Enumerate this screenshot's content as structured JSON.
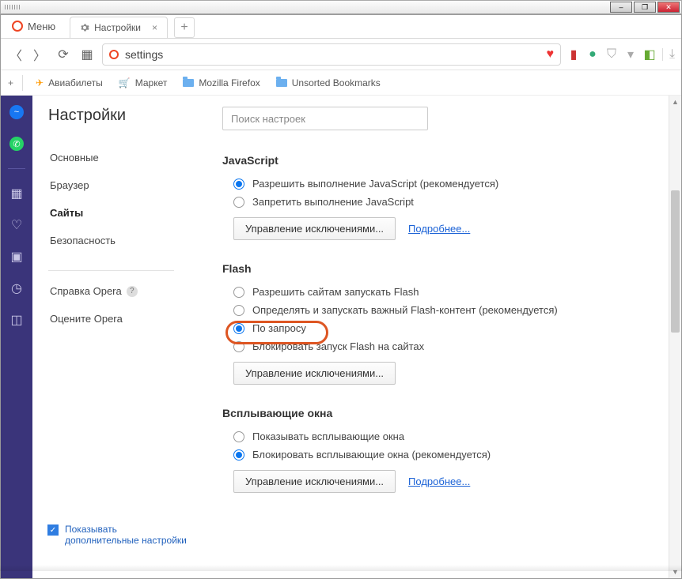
{
  "window": {
    "minimize": "–",
    "maximize": "❐",
    "close": "✕"
  },
  "menu_label": "Меню",
  "tab": {
    "title": "Настройки",
    "close": "×",
    "new": "+"
  },
  "url": {
    "value": "settings"
  },
  "bookmarks": {
    "add": "+",
    "items": [
      {
        "label": "Авиабилеты"
      },
      {
        "label": "Маркет"
      },
      {
        "label": "Mozilla Firefox"
      },
      {
        "label": "Unsorted Bookmarks"
      }
    ]
  },
  "settings_title": "Настройки",
  "nav": {
    "main": [
      "Основные",
      "Браузер",
      "Сайты",
      "Безопасность"
    ],
    "active_index": 2,
    "secondary": [
      "Справка Opera",
      "Оцените Opera"
    ]
  },
  "advanced_checkbox": "Показывать дополнительные настройки",
  "search_placeholder": "Поиск настроек",
  "sections": {
    "js": {
      "title": "JavaScript",
      "opt1": "Разрешить выполнение JavaScript (рекомендуется)",
      "opt2": "Запретить выполнение JavaScript",
      "manage": "Управление исключениями...",
      "more": "Подробнее..."
    },
    "flash": {
      "title": "Flash",
      "opt1": "Разрешить сайтам запускать Flash",
      "opt2": "Определять и запускать важный Flash-контент (рекомендуется)",
      "opt3": "По запросу",
      "opt4": "Блокировать запуск Flash на сайтах",
      "manage": "Управление исключениями..."
    },
    "popups": {
      "title": "Всплывающие окна",
      "opt1": "Показывать всплывающие окна",
      "opt2": "Блокировать всплывающие окна (рекомендуется)",
      "manage": "Управление исключениями...",
      "more": "Подробнее..."
    }
  }
}
